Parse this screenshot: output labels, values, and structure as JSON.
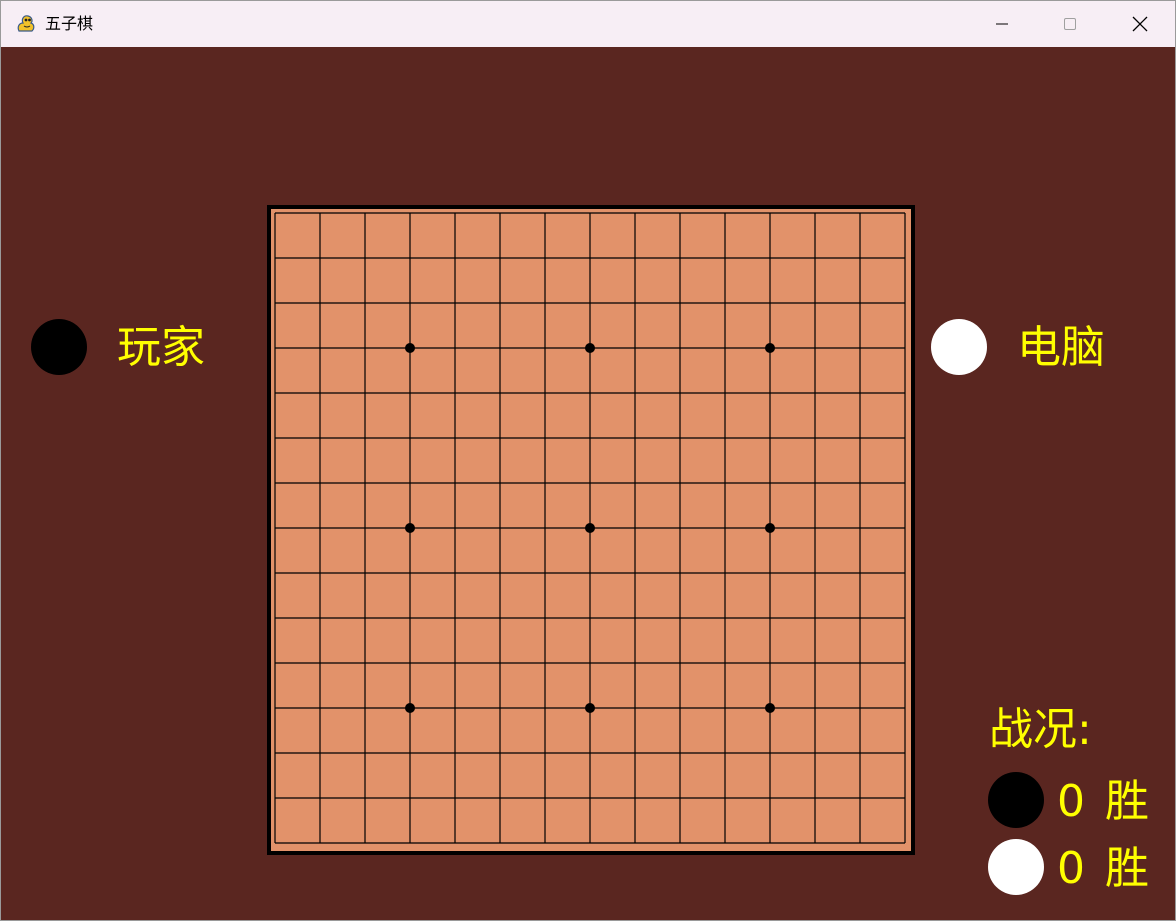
{
  "window": {
    "title": "五子棋",
    "icon": "pygame-snake-icon",
    "controls": [
      "minimize-icon",
      "maximize-icon",
      "close-icon"
    ]
  },
  "colors": {
    "background": "#5a2620",
    "board": "#e2926a",
    "grid": "#000000",
    "label": "#ffff00",
    "black_stone": "#000000",
    "white_stone": "#ffffff"
  },
  "board": {
    "size": 15,
    "star_points": [
      [
        3,
        3
      ],
      [
        3,
        7
      ],
      [
        3,
        11
      ],
      [
        7,
        3
      ],
      [
        7,
        7
      ],
      [
        7,
        11
      ],
      [
        11,
        3
      ],
      [
        11,
        7
      ],
      [
        11,
        11
      ]
    ],
    "stones": []
  },
  "players": {
    "player": {
      "label": "玩家",
      "stone": "black"
    },
    "computer": {
      "label": "电脑",
      "stone": "white"
    }
  },
  "record": {
    "title": "战况:",
    "black_wins": "0",
    "white_wins": "0",
    "win_label": "胜"
  }
}
